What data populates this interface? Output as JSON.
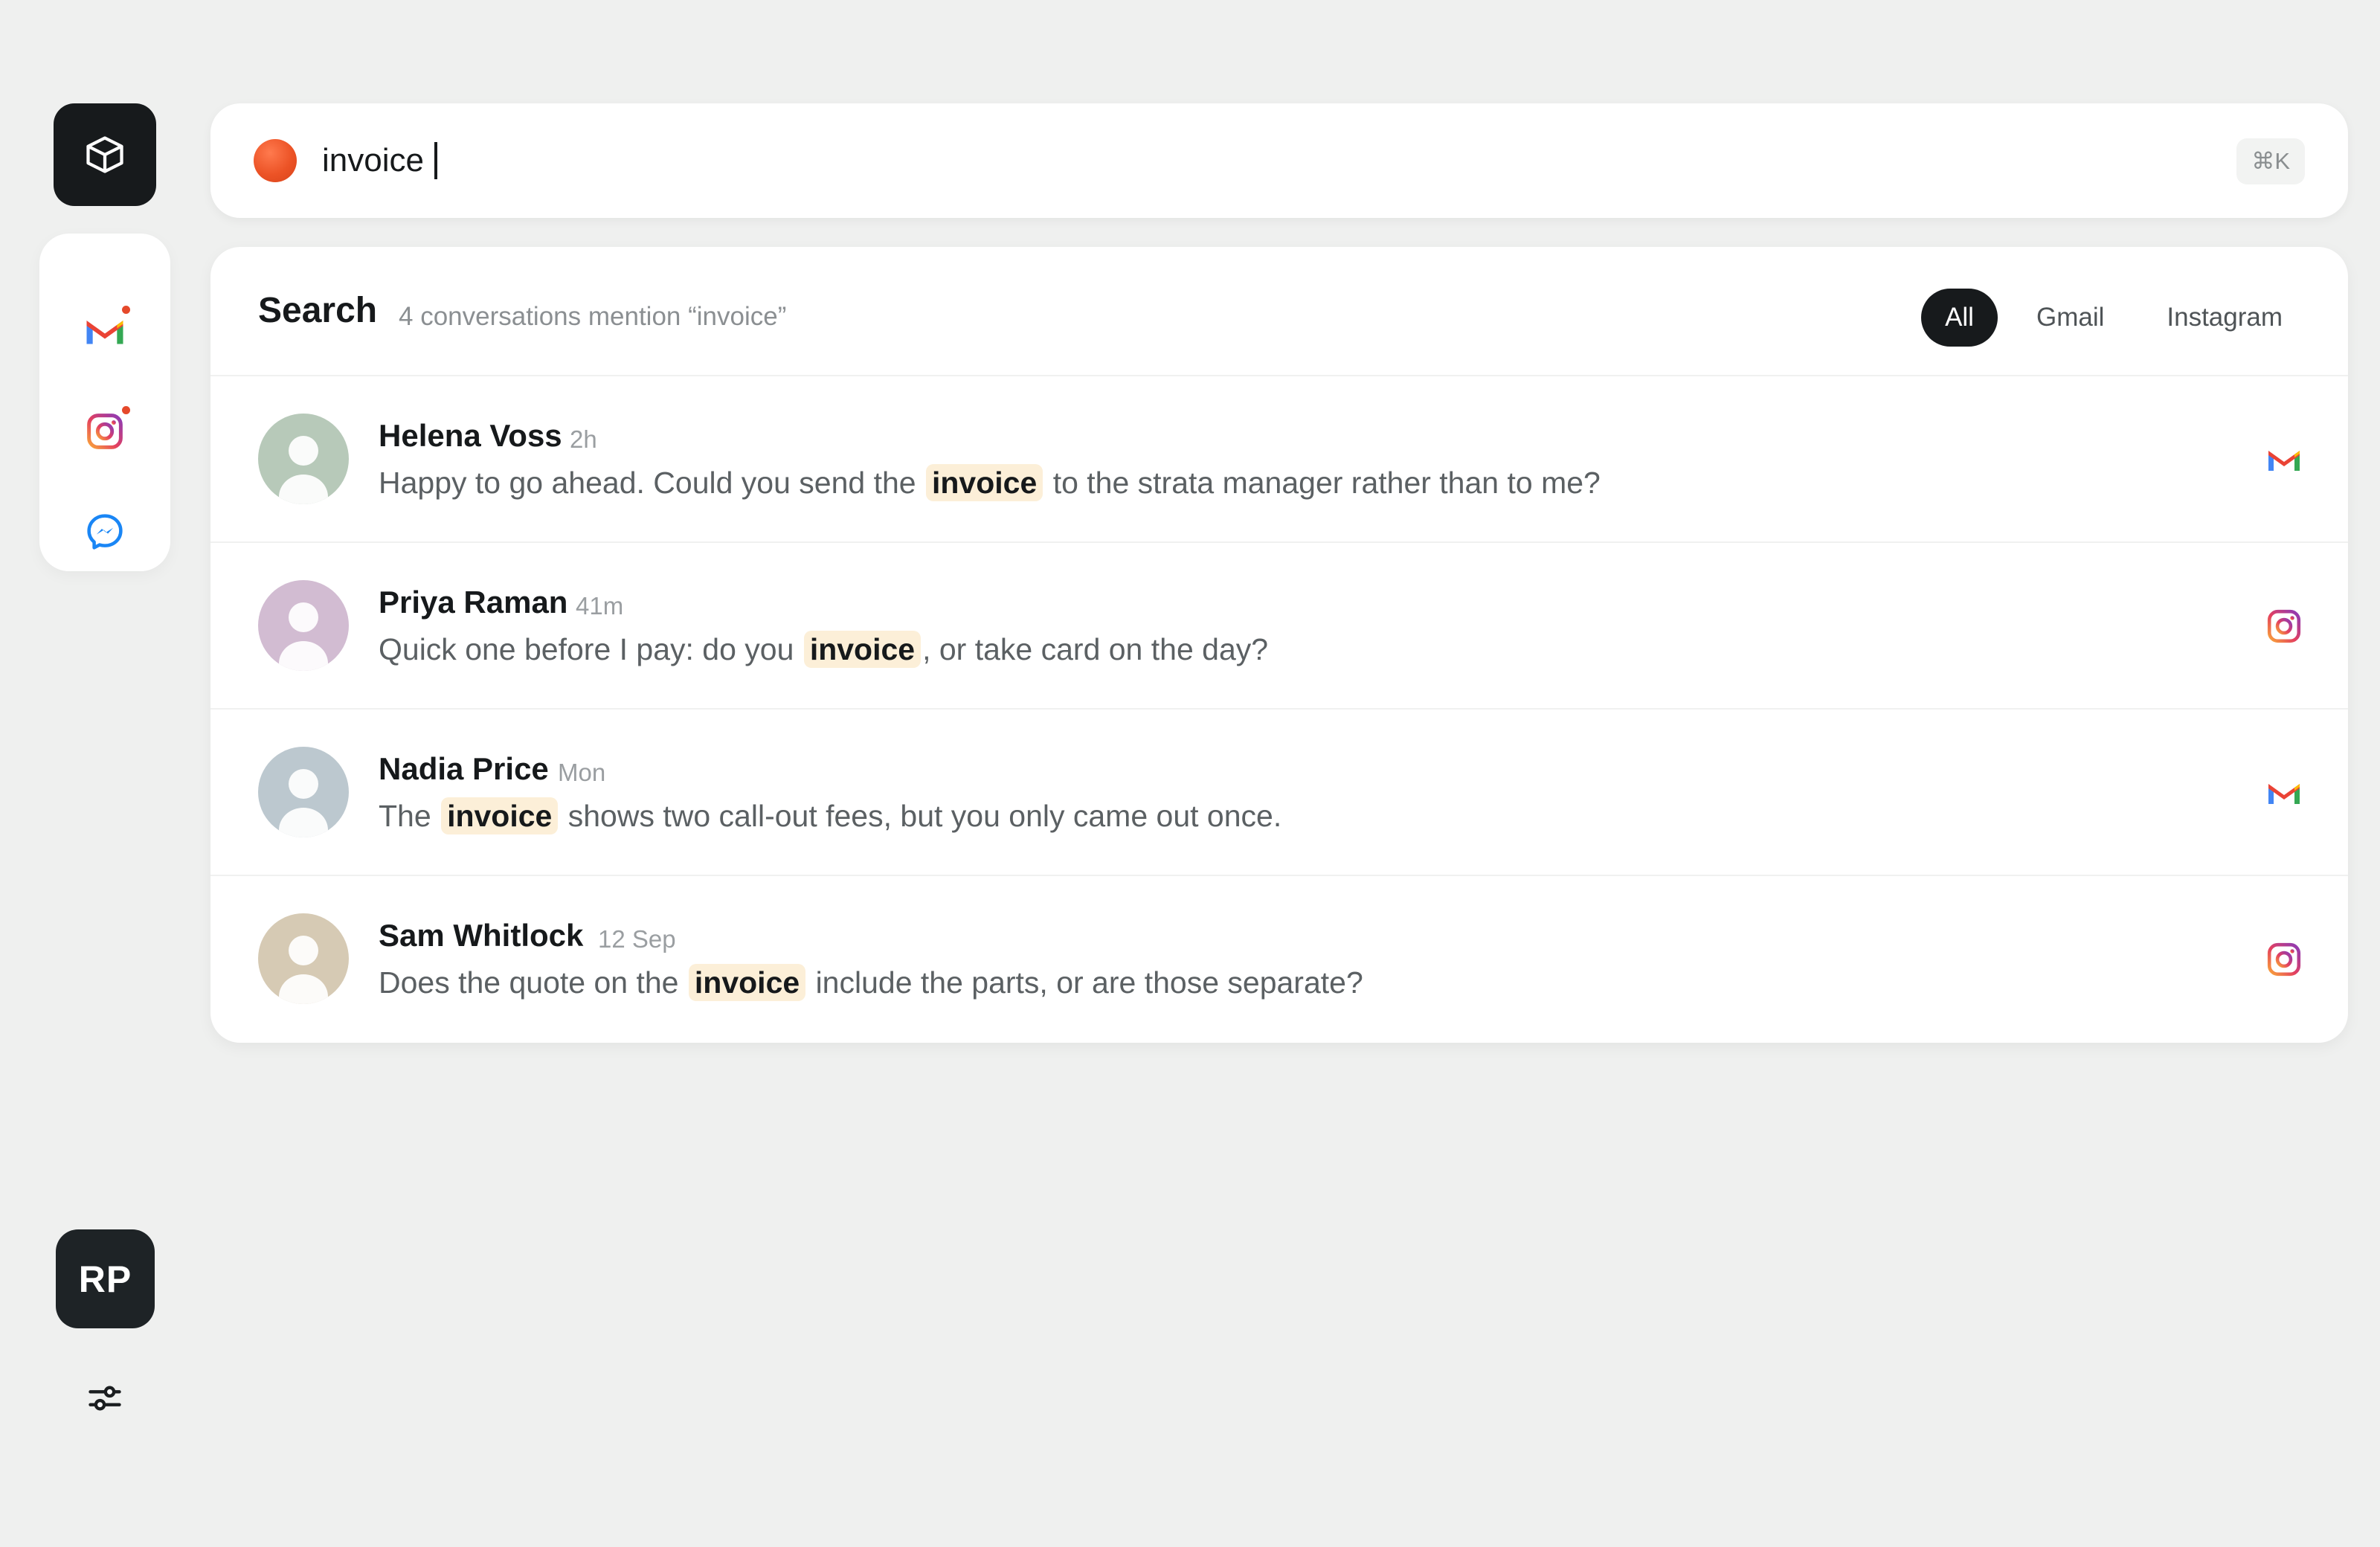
{
  "search": {
    "query": "invoice",
    "shortcut": "⌘K"
  },
  "sidebar": {
    "channels": [
      {
        "name": "Gmail",
        "icon": "gmail-icon",
        "unread": true
      },
      {
        "name": "Instagram",
        "icon": "instagram-icon",
        "unread": true
      },
      {
        "name": "Messenger",
        "icon": "messenger-icon",
        "unread": false
      }
    ],
    "user_initials": "RP"
  },
  "results": {
    "title": "Search",
    "summary": "4 conversations mention “invoice”",
    "filters": [
      {
        "label": "All",
        "active": true
      },
      {
        "label": "Gmail",
        "active": false
      },
      {
        "label": "Instagram",
        "active": false
      }
    ],
    "items": [
      {
        "name": "Helena Voss",
        "time": "2h",
        "channel": "gmail",
        "avatar_color": "#b7c9b9",
        "message": {
          "before": "Happy to go ahead. Could you send the",
          "match": "invoice",
          "after": "to the strata manager rather than to me?"
        }
      },
      {
        "name": "Priya Raman",
        "time": "41m",
        "channel": "instagram",
        "avatar_color": "#d2bcd2",
        "message": {
          "before": "Quick one before I pay: do you",
          "match": "invoice",
          "after": ", or take card on the day?"
        }
      },
      {
        "name": "Nadia Price",
        "time": "Mon",
        "channel": "gmail",
        "avatar_color": "#bcc8cf",
        "message": {
          "before": "The",
          "match": "invoice",
          "after": "shows two call-out fees, but you only came out once."
        }
      },
      {
        "name": "Sam Whitlock",
        "time": "12 Sep",
        "channel": "instagram",
        "avatar_color": "#d6cab4",
        "message": {
          "before": "Does the quote on the",
          "match": "invoice",
          "after": "include the parts, or are those separate?"
        }
      }
    ]
  },
  "colors": {
    "background": "#eff0ef",
    "accent_dark": "#171a1c",
    "highlight": "#fcefd8",
    "search_orb": "#ec5326"
  }
}
